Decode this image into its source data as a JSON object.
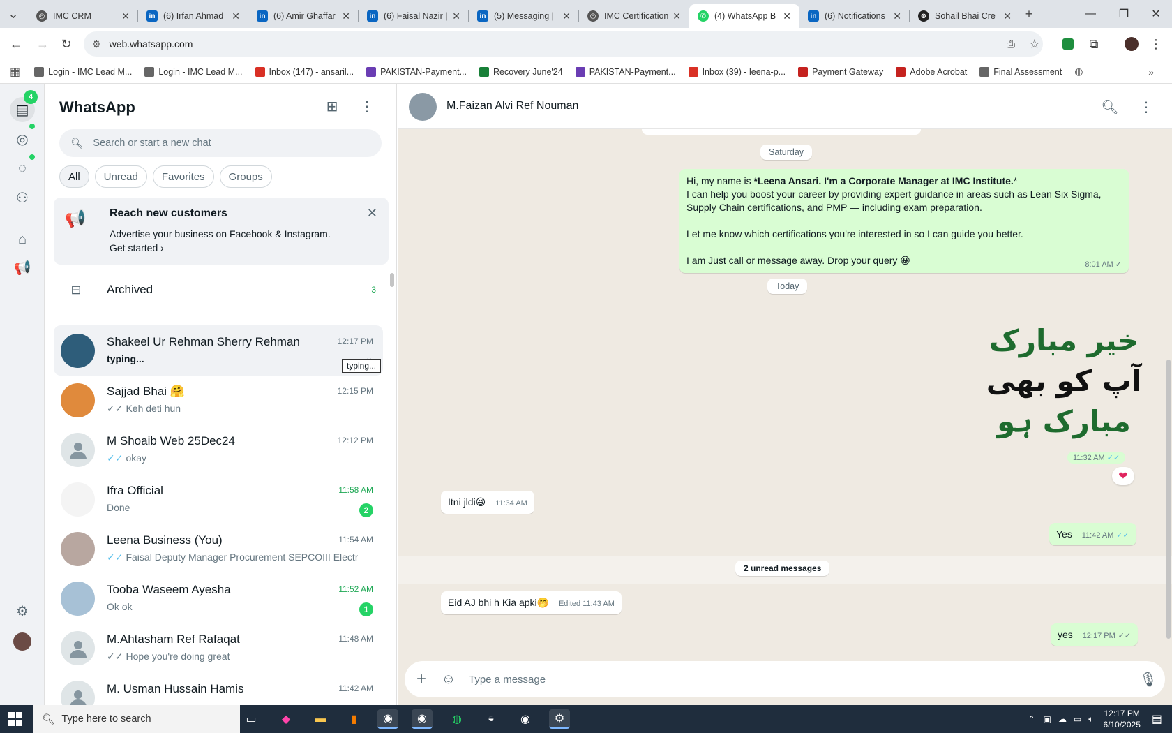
{
  "browser": {
    "tabs": [
      {
        "label": "IMC CRM",
        "favicon": "imc"
      },
      {
        "label": "(6) Irfan Ahmad",
        "favicon": "linkedin"
      },
      {
        "label": "(6) Amir Ghaffar",
        "favicon": "linkedin"
      },
      {
        "label": "(6) Faisal Nazir |",
        "favicon": "linkedin"
      },
      {
        "label": "(5) Messaging |",
        "favicon": "linkedin"
      },
      {
        "label": "IMC Certification",
        "favicon": "imc"
      },
      {
        "label": "(4) WhatsApp B",
        "favicon": "whatsapp",
        "active": true
      },
      {
        "label": "(6) Notifications",
        "favicon": "linkedin"
      },
      {
        "label": "Sohail Bhai Cre",
        "favicon": "openai"
      }
    ],
    "url": "web.whatsapp.com",
    "bookmarks": [
      {
        "label": "Login - IMC Lead M...",
        "color": "#666"
      },
      {
        "label": "Login - IMC Lead M...",
        "color": "#666"
      },
      {
        "label": "Inbox (147) - ansaril...",
        "color": "#d93025"
      },
      {
        "label": "PAKISTAN-Payment...",
        "color": "#6a3db3"
      },
      {
        "label": "Recovery June'24",
        "color": "#188038"
      },
      {
        "label": "PAKISTAN-Payment...",
        "color": "#6a3db3"
      },
      {
        "label": "Inbox (39) - leena-p...",
        "color": "#d93025"
      },
      {
        "label": "Payment Gateway",
        "color": "#c5221f"
      },
      {
        "label": "Adobe Acrobat",
        "color": "#c5221f"
      },
      {
        "label": "Final Assessment",
        "color": "#666"
      }
    ]
  },
  "rail": {
    "chats_badge": "4"
  },
  "sidebar": {
    "title": "WhatsApp",
    "search_placeholder": "Search or start a new chat",
    "filters": [
      "All",
      "Unread",
      "Favorites",
      "Groups"
    ],
    "promo": {
      "title": "Reach new customers",
      "body": "Advertise your business on Facebook & Instagram.",
      "link": "Get started"
    },
    "archived": {
      "label": "Archived",
      "count": "3"
    },
    "tooltip": "typing...",
    "chats": [
      {
        "name": "Shakeel Ur Rehman Sherry Rehman",
        "time": "12:17 PM",
        "preview": "typing...",
        "tick": "",
        "badge": "",
        "avatar_color": "#2e5d7a"
      },
      {
        "name": "Sajjad Bhai 🤗",
        "time": "12:15 PM",
        "preview": "Keh deti hun",
        "tick": "✓✓",
        "tick_read": false,
        "badge": "",
        "avatar_color": "#e08a3c"
      },
      {
        "name": "M Shoaib Web 25Dec24",
        "time": "12:12 PM",
        "preview": "okay",
        "tick": "✓✓",
        "tick_read": true,
        "badge": "",
        "avatar_color": ""
      },
      {
        "name": "Ifra Official",
        "time": "11:58 AM",
        "preview": "Done",
        "tick": "",
        "badge": "2",
        "avatar_color": "#f4f4f4"
      },
      {
        "name": "Leena Business (You)",
        "time": "11:54 AM",
        "preview": "Faisal Deputy Manager Procurement SEPCOIII Electric P...",
        "tick": "✓✓",
        "tick_read": true,
        "badge": "",
        "avatar_color": "#b8a7a0"
      },
      {
        "name": "Tooba Waseem Ayesha",
        "time": "11:52 AM",
        "preview": "Ok ok",
        "tick": "",
        "badge": "1",
        "avatar_color": "#a7c1d6"
      },
      {
        "name": "M.Ahtasham Ref Rafaqat",
        "time": "11:48 AM",
        "preview": "Hope you're doing great",
        "tick": "✓✓",
        "tick_read": false,
        "badge": "",
        "avatar_color": ""
      },
      {
        "name": "M. Usman Hussain Hamis",
        "time": "11:42 AM",
        "preview": "",
        "tick": "",
        "badge": "",
        "avatar_color": ""
      }
    ]
  },
  "conversation": {
    "contact_name": "M.Faizan Alvi Ref Nouman",
    "date_saturday": "Saturday",
    "intro_message": {
      "line1_prefix": "Hi, my name is ",
      "line1_bold": "*Leena Ansari. I'm a Corporate Manager at IMC Institute.",
      "line1_suffix": "*",
      "line2": "I can help you boost your career by providing expert guidance in areas such as Lean Six Sigma,",
      "line3": "Supply Chain certifications, and PMP — including exam preparation.",
      "line4": "Let me know which certifications you're interested in so I can guide you better.",
      "line5": "I am Just call or message away. Drop your query 😀",
      "time": "8:01 AM",
      "tick": "✓"
    },
    "date_today": "Today",
    "sticker": {
      "line1": "خیر مبارک",
      "line2": "آپ کو بھی",
      "line3": "مبارک ہو",
      "time": "11:32 AM",
      "tick": "✓✓",
      "reaction": "❤"
    },
    "msg_itni": {
      "text": "Itni jldi😆",
      "time": "11:34 AM"
    },
    "msg_yes": {
      "text": "Yes",
      "time": "11:42 AM",
      "tick": "✓✓"
    },
    "unread_label": "2 unread messages",
    "msg_eid": {
      "text": "Eid AJ bhi h Kia apki🤭",
      "time": "Edited 11:43 AM"
    },
    "msg_yes2": {
      "text": "yes",
      "time": "12:17 PM",
      "tick": "✓✓"
    },
    "composer_placeholder": "Type a message"
  },
  "taskbar": {
    "search_placeholder": "Type here to search",
    "time": "12:17 PM",
    "date": "6/10/2025"
  }
}
